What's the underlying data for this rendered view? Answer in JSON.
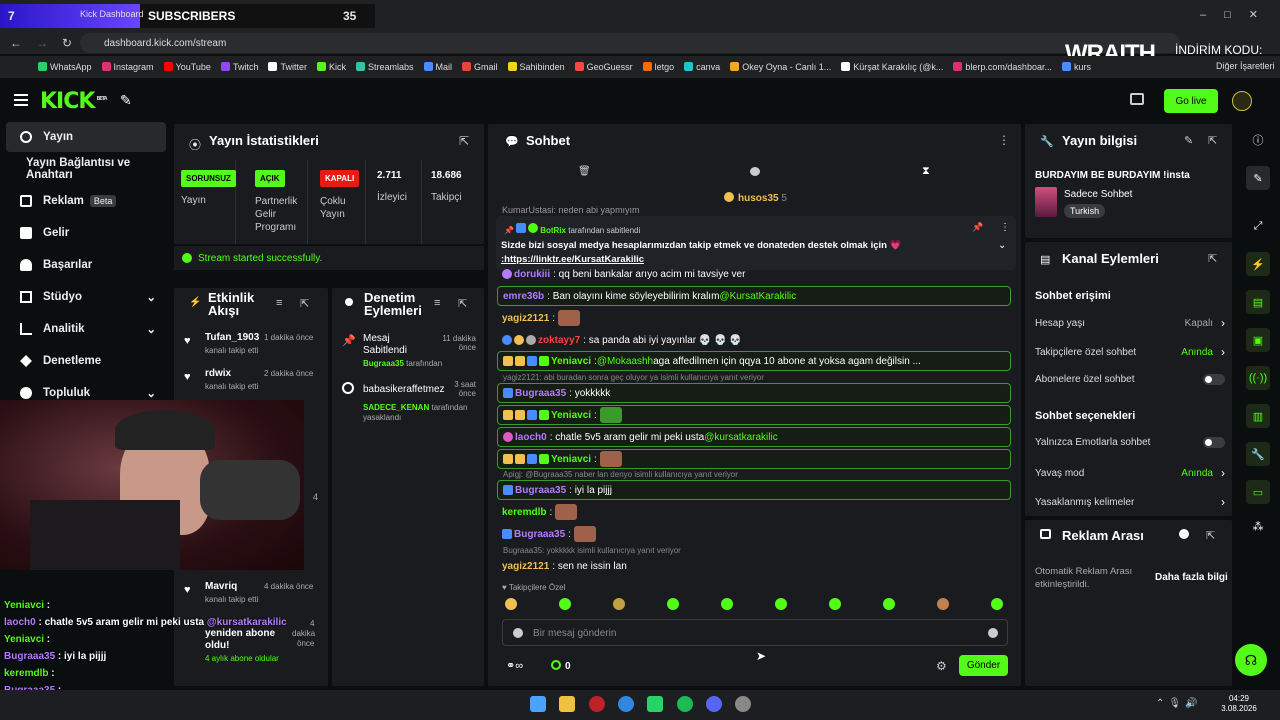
{
  "browser": {
    "overlay_number": "7",
    "tab_title": "Kick Dashboard",
    "subs_label": "SUBSCRIBERS",
    "subs_count": "35",
    "url": "dashboard.kick.com/stream",
    "bookmarks": [
      "WhatsApp",
      "Instagram",
      "YouTube",
      "Twitch",
      "Twitter",
      "Kick",
      "Streamlabs",
      "Mail",
      "Gmail",
      "Sahibinden",
      "GeoGuessr",
      "letgo",
      "canva",
      "Okey Oyna - Canlı 1...",
      "Kürşat Karakılıç (@k...",
      "blerp.com/dashboar...",
      "kurs"
    ],
    "bookmark_colors": [
      "#25d366",
      "#e1306c",
      "#ff0000",
      "#9146ff",
      "#ffffff",
      "#53fc18",
      "#31c3a2",
      "#4a8cff",
      "#ea4335",
      "#f7d21a",
      "#ff4444",
      "#ff6a00",
      "#20c4cb",
      "#f5a623",
      "#ffffff",
      "#e0306c",
      "#4a8cff"
    ],
    "other_bookmarks": "Diğer İşaretleri",
    "ad_brand": "WRAITH.",
    "ad_code_label": "İNDİRİM KODU:",
    "ad_code": "QQ"
  },
  "header": {
    "logo": "KICK",
    "logo_beta": "BETA",
    "go_live": "Go live"
  },
  "sidebar": {
    "items": [
      {
        "label": "Yayın"
      },
      {
        "label": "Yayın Bağlantısı ve Anahtarı"
      },
      {
        "label": "Reklam",
        "badge": "Beta"
      },
      {
        "label": "Gelir"
      },
      {
        "label": "Başarılar"
      },
      {
        "label": "Stüdyo"
      },
      {
        "label": "Analitik"
      },
      {
        "label": "Denetleme"
      },
      {
        "label": "Topluluk"
      }
    ]
  },
  "stats": {
    "title": "Yayın İstatistikleri",
    "cols": [
      {
        "badge": "SORUNSUZ",
        "badge_color": "#53fc18",
        "label": "Yayın"
      },
      {
        "badge": "AÇIK",
        "badge_color": "#53fc18",
        "label": "Partnerlik Gelir Programı"
      },
      {
        "badge": "KAPALI",
        "badge_color": "#e91916",
        "label": "Çoklu Yayın"
      },
      {
        "value": "2.711",
        "label": "İzleyici"
      },
      {
        "value": "18.686",
        "label": "Takipçi"
      }
    ],
    "status_message": "Stream started successfully."
  },
  "activity": {
    "title": "Etkinlik Akışı",
    "items": [
      {
        "name": "Tufan_1903",
        "time": "1 dakika önce",
        "sub": "kanalı takip etti"
      },
      {
        "name": "rdwix",
        "time": "2 dakika önce",
        "sub": "kanalı takip etti"
      },
      {
        "name": "Mavriq",
        "time": "4 dakika önce",
        "sub": "kanalı takip etti"
      }
    ],
    "sub_item": {
      "line1": "yeniden abone",
      "line2": "oldu!",
      "months": "4 aylık abone oldular",
      "time1": "4",
      "time2": "dakika",
      "time3": "önce"
    },
    "partial_time": "4"
  },
  "moderation": {
    "title": "Denetim Eylemleri",
    "items": [
      {
        "title": "Mesaj Sabitlendi",
        "actor": "Bugraaa35",
        "action": "tarafından",
        "time": "11 dakika önce"
      },
      {
        "title": "babasikeraffetmez",
        "actor": "SADECE_KENAN",
        "action": "tarafından yasaklandı",
        "time": "3 saat önce"
      }
    ]
  },
  "chat": {
    "title": "Sohbet",
    "top_user": "husos35",
    "top_user_count": "5",
    "cut_line": "KumarUstasi: neden abi yapmıyım",
    "pinned": {
      "by": "BotRix",
      "by_suffix": "tarafından sabitlendi",
      "text": "Sizde bizi sosyal medya hesaplarımızdan takip etmek ve donateden destek olmak için 💗",
      "link": ":https://linktr.ee/KursatKarakilic"
    },
    "messages": [
      {
        "user": "dorukiii",
        "color": "#b57bff",
        "text": ": qq beni bankalar arıyo acim mi tavsiye ver"
      },
      {
        "user": "emre36b",
        "color": "#b57bff",
        "text": ": Ban olayını kime söyleyebilirim kralım ",
        "mention": "@KursatKarakilic",
        "highlight": true
      },
      {
        "user": "yagiz2121",
        "color": "#f0c050",
        "text": ":"
      },
      {
        "user": "zoktayy7",
        "color": "#ff4040",
        "text": ": sa panda abi iyi yayınlar 💀 💀 💀"
      },
      {
        "user": "Yeniavci",
        "color": "#53fc18",
        "text": ": ",
        "mention": "@Mokaashh",
        "after": " aga affedilmen için qqya 10 abone at yoksa agam değilsin ...",
        "highlight": true
      },
      {
        "user": "Bugraaa35",
        "color": "#b57bff",
        "text": ": yokkkkk",
        "reply": "yagiz2121: abi buradan sonra geç oluyor ya isimli kullanıcıya yanıt veriyor",
        "highlight": true
      },
      {
        "user": "Yeniavci",
        "color": "#53fc18",
        "text": ":",
        "highlight": true
      },
      {
        "user": "laoch0",
        "color": "#b57bff",
        "text": ": chatle 5v5 aram gelir mi peki usta ",
        "mention": "@kursatkarakilic",
        "highlight": true
      },
      {
        "user": "Yeniavci",
        "color": "#53fc18",
        "text": ":",
        "highlight": true
      },
      {
        "user": "Bugraaa35",
        "color": "#b57bff",
        "text": ": iyi la pijjj",
        "reply": "Apigj: @Bugraaa35 naber lan denyo isimli kullanıcıya yanıt veriyor",
        "highlight": true
      },
      {
        "user": "keremdlb",
        "color": "#53fc18",
        "text": ":"
      },
      {
        "user": "Bugraaa35",
        "color": "#b57bff",
        "text": ":"
      },
      {
        "user": "yagiz2121",
        "color": "#f0c050",
        "text": ": sen ne issin lan",
        "reply": "Bugraaa35: yokkkkk isimli kullanıcıya yanıt veriyor"
      }
    ],
    "followers_only": "Takipçilere Özel",
    "input_placeholder": "Bir mesaj gönderin",
    "points": "0",
    "send": "Gönder"
  },
  "stream_info": {
    "title": "Yayın bilgisi",
    "stream_title": "BURDAYIM BE BURDAYIM !insta",
    "category": "Sadece Sohbet",
    "language": "Turkish"
  },
  "channel_actions": {
    "title": "Kanal Eylemleri",
    "chat_access": "Sohbet erişimi",
    "rows1": [
      {
        "label": "Hesap yaşı",
        "value": "Kapalı",
        "type": "link"
      },
      {
        "label": "Takipçilere özel sohbet",
        "value": "Anında",
        "type": "link-green"
      },
      {
        "label": "Abonelere özel sohbet",
        "type": "toggle"
      }
    ],
    "chat_options": "Sohbet seçenekleri",
    "rows2": [
      {
        "label": "Yalnızca Emotlarla sohbet",
        "type": "toggle"
      },
      {
        "label": "Yavaş mod",
        "value": "Anında",
        "type": "link-green"
      },
      {
        "label": "Yasaklanmış kelimeler",
        "type": "link"
      }
    ]
  },
  "ad_break": {
    "title": "Reklam Arası",
    "text": "Otomatik Reklam Arası etkinleştirildi.",
    "link": "Daha fazla bilgi"
  },
  "overlay_chat": [
    {
      "user": "Yeniavci",
      "color": "#53fc18",
      "text": " :"
    },
    {
      "user": "laoch0",
      "color": "#b57bff",
      "text": " : chatle 5v5 aram gelir mi peki usta ",
      "mention": "@kursatkarakilic"
    },
    {
      "user": "Yeniavci",
      "color": "#53fc18",
      "text": " :"
    },
    {
      "user": "Bugraaa35",
      "color": "#b57bff",
      "text": " : iyi la pijjj"
    },
    {
      "user": "keremdlb",
      "color": "#53fc18",
      "text": " :"
    },
    {
      "user": "Bugraaa35",
      "color": "#b57bff",
      "text": " :"
    },
    {
      "user": "yagiz2121",
      "color": "#ffffff",
      "text": " : sen ne issin lan"
    }
  ],
  "taskbar": {
    "time": "04:29",
    "date": "3.08.2026"
  },
  "colors": {
    "accent": "#53fc18",
    "danger": "#e91916"
  }
}
